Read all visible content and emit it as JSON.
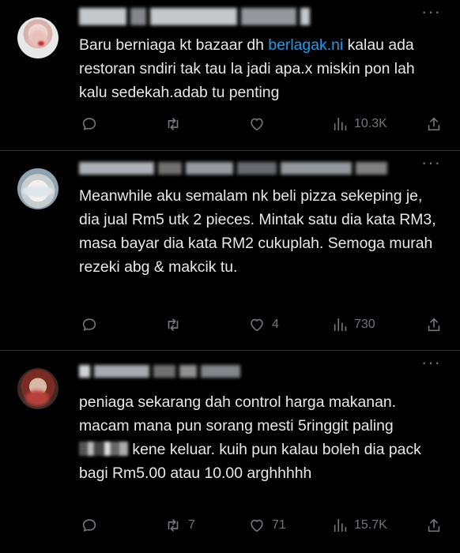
{
  "colors": {
    "background": "#000000",
    "text": "#e7e9ea",
    "muted": "#71767b",
    "link": "#1d9bf0",
    "divider": "#2f3336"
  },
  "icons": {
    "reply": "reply-icon",
    "retweet": "retweet-icon",
    "like": "heart-icon",
    "views": "views-icon",
    "share": "share-icon",
    "more": "more-icon"
  },
  "more_label": "···",
  "tweets": [
    {
      "text_before": "Baru berniaga kt bazaar dh ",
      "link": "berlagak.ni",
      "text_after": " kalau ada restoran sndiri tak tau la jadi apa.x miskin pon lah kalu sedekah.adab tu penting",
      "replies": "",
      "retweets": "",
      "likes": "",
      "views": "10.3K"
    },
    {
      "text": "Meanwhile aku semalam nk beli pizza sekeping je, dia jual Rm5 utk 2 pieces. Mintak satu dia kata RM3, masa bayar dia kata RM2 cukuplah. Semoga murah rezeki abg & makcik tu.",
      "replies": "",
      "retweets": "",
      "likes": "4",
      "views": "730"
    },
    {
      "text_before": "peniaga sekarang dah control harga makanan. macam mana pun sorang mesti 5ringgit paling ",
      "text_after": " kene keluar. kuih pun kalau boleh dia pack bagi Rm5.00 atau 10.00 arghhhhh",
      "replies": "",
      "retweets": "7",
      "likes": "71",
      "views": "15.7K"
    }
  ]
}
